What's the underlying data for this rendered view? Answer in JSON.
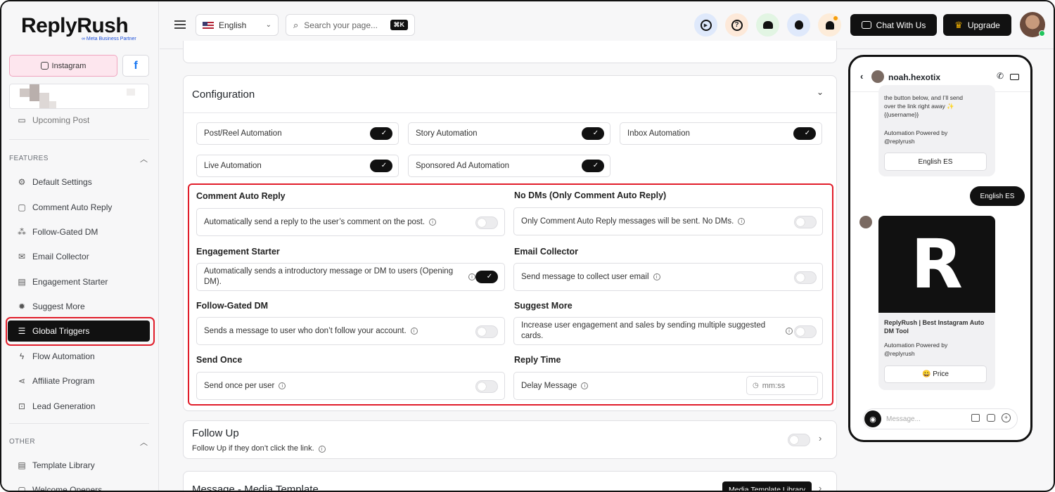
{
  "brand": {
    "name": "ReplyRush",
    "subtitle": "∞ Meta Business Partner"
  },
  "accounts": {
    "instagram_label": "Instagram",
    "facebook_label": "f"
  },
  "sidebar": {
    "partial_item": "Upcoming Post",
    "features_label": "FEATURES",
    "features": [
      {
        "label": "Default Settings",
        "icon": "gear-icon"
      },
      {
        "label": "Comment Auto Reply",
        "icon": "comment-icon"
      },
      {
        "label": "Follow-Gated DM",
        "icon": "follow-icon"
      },
      {
        "label": "Email Collector",
        "icon": "email-icon"
      },
      {
        "label": "Engagement Starter",
        "icon": "engagement-icon"
      },
      {
        "label": "Suggest More",
        "icon": "suggest-icon"
      },
      {
        "label": "Global Triggers",
        "icon": "list-icon",
        "active": true
      },
      {
        "label": "Flow Automation",
        "icon": "bolt-icon"
      },
      {
        "label": "Affiliate Program",
        "icon": "share-icon"
      },
      {
        "label": "Lead Generation",
        "icon": "lead-icon"
      }
    ],
    "other_label": "OTHER",
    "other": [
      {
        "label": "Template Library",
        "icon": "template-icon"
      },
      {
        "label": "Welcome Openers",
        "icon": "welcome-icon"
      }
    ]
  },
  "header": {
    "language": "English",
    "search_placeholder": "Search your page...",
    "shortcut": "⌘K",
    "chat_label": "Chat With Us",
    "upgrade_label": "Upgrade"
  },
  "configuration": {
    "title": "Configuration",
    "toggles": [
      {
        "label": "Post/Reel Automation",
        "on": true
      },
      {
        "label": "Story Automation",
        "on": true
      },
      {
        "label": "Inbox Automation",
        "on": true
      },
      {
        "label": "Live Automation",
        "on": true
      },
      {
        "label": "Sponsored Ad Automation",
        "on": true
      }
    ]
  },
  "options": [
    {
      "title": "Comment Auto Reply",
      "desc": "Automatically send a reply to the user’s comment on the post.",
      "on": false
    },
    {
      "title": "No DMs (Only Comment Auto Reply)",
      "desc": "Only Comment Auto Reply messages will be sent. No DMs.",
      "on": false
    },
    {
      "title": "Engagement Starter",
      "desc": "Automatically sends a introductory message or DM to users (Opening DM).",
      "on": true
    },
    {
      "title": "Email Collector",
      "desc": "Send message to collect user email",
      "on": false
    },
    {
      "title": "Follow-Gated DM",
      "desc": "Sends a message to user who don’t follow your account.",
      "on": false
    },
    {
      "title": "Suggest More",
      "desc": "Increase user engagement and sales by sending multiple suggested cards.",
      "on": false
    },
    {
      "title": "Send Once",
      "desc": "Send once per user",
      "on": false
    },
    {
      "title": "Reply Time",
      "desc": "Delay Message",
      "placeholder": "mm:ss"
    }
  ],
  "follow_up": {
    "title": "Follow Up",
    "desc": "Follow Up if they don’t click the link.",
    "on": false
  },
  "media_template": {
    "title": "Message - Media Template",
    "button": "Media Template Library"
  },
  "phone": {
    "username": "noah.hexotix",
    "msg1_lines": [
      "the button below, and I’ll send",
      "over the link right away ✨",
      "{{username}}"
    ],
    "powered": "Automation Powered by",
    "powered_handle": "@replyrush",
    "btn1": "English ES",
    "bubble": "English ES",
    "image_letter": "R",
    "card_title": "ReplyRush | Best Instagram Auto DM Tool",
    "card_powered": "Automation Powered by",
    "card_handle": "@replyrush",
    "price_btn": "😀 Price",
    "input_placeholder": "Message..."
  }
}
